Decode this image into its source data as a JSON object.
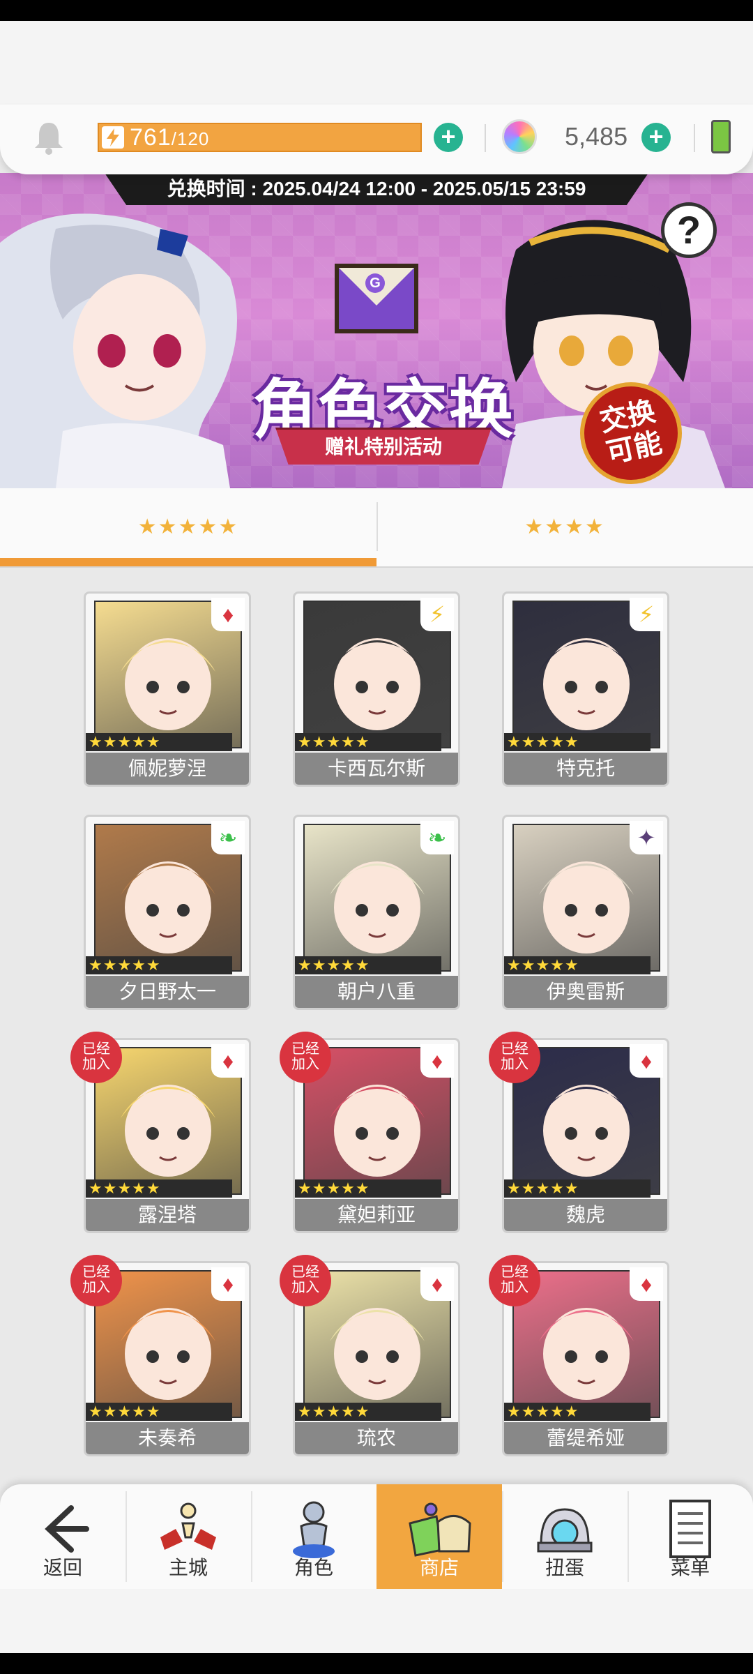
{
  "header": {
    "energy_current": "761",
    "energy_max": "/120",
    "gem_value": "5,485",
    "plus_label": "+"
  },
  "banner": {
    "period_text": "兑换时间 : 2025.04/24 12:00 - 2025.05/15 23:59",
    "title": "角色交换",
    "subtitle": "赠礼特别活动",
    "stamp_line1": "交换",
    "stamp_line2": "可能",
    "envelope_letter": "G",
    "help_label": "?"
  },
  "tabs": [
    {
      "label": "★★★★★",
      "active": true
    },
    {
      "label": "★★★★",
      "active": false
    }
  ],
  "characters": [
    {
      "name": "佩妮萝涅",
      "stars": "★★★★★",
      "attribute": "♦",
      "added": false,
      "hue": "#f5dc90"
    },
    {
      "name": "卡西瓦尔斯",
      "stars": "★★★★★",
      "attribute": "⚡",
      "added": false,
      "hue": "#3a3a3a"
    },
    {
      "name": "特克托",
      "stars": "★★★★★",
      "attribute": "⚡",
      "added": false,
      "hue": "#2e2e3e"
    },
    {
      "name": "夕日野太一",
      "stars": "★★★★★",
      "attribute": "❧",
      "added": false,
      "hue": "#b07a4a"
    },
    {
      "name": "朝户八重",
      "stars": "★★★★★",
      "attribute": "❧",
      "added": false,
      "hue": "#e8e4c8"
    },
    {
      "name": "伊奥雷斯",
      "stars": "★★★★★",
      "attribute": "✦",
      "added": false,
      "hue": "#d8d0c0"
    },
    {
      "name": "露涅塔",
      "stars": "★★★★★",
      "attribute": "♦",
      "added": true,
      "hue": "#f7d66e"
    },
    {
      "name": "黛妲莉亚",
      "stars": "★★★★★",
      "attribute": "♦",
      "added": true,
      "hue": "#d65066"
    },
    {
      "name": "魏虎",
      "stars": "★★★★★",
      "attribute": "♦",
      "added": true,
      "hue": "#2c2c4a"
    },
    {
      "name": "未奏希",
      "stars": "★★★★★",
      "attribute": "♦",
      "added": true,
      "hue": "#f0934a"
    },
    {
      "name": "琉农",
      "stars": "★★★★★",
      "attribute": "♦",
      "added": true,
      "hue": "#ece2a8"
    },
    {
      "name": "蕾缇希娅",
      "stars": "★★★★★",
      "attribute": "♦",
      "added": true,
      "hue": "#ec6f8a"
    }
  ],
  "added_badge": {
    "line1": "已经",
    "line2": "加入"
  },
  "nav": {
    "back": "返回",
    "main_city": "主城",
    "characters": "角色",
    "shop": "商店",
    "gacha": "扭蛋",
    "menu": "菜单"
  },
  "colors": {
    "accent_orange": "#f09a36",
    "plus_green": "#27b391",
    "added_red": "#d9343f"
  }
}
